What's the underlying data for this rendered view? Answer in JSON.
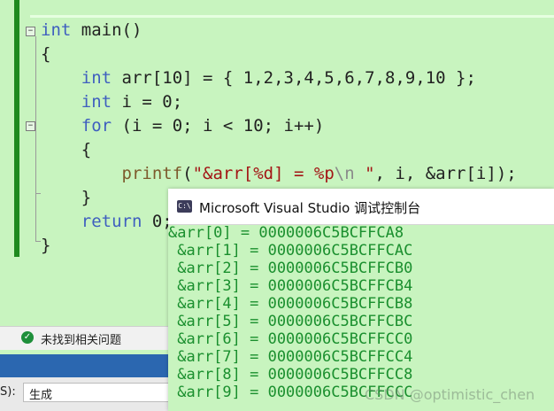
{
  "editor": {
    "lines": [
      {
        "parts": [
          {
            "t": "int",
            "c": "kw"
          },
          {
            "t": " main()",
            "c": ""
          }
        ]
      },
      {
        "parts": [
          {
            "t": "{",
            "c": ""
          }
        ]
      },
      {
        "parts": [
          {
            "t": "    ",
            "c": ""
          },
          {
            "t": "int",
            "c": "kw"
          },
          {
            "t": " arr[10] = { 1,2,3,4,5,6,7,8,9,10 };",
            "c": ""
          }
        ]
      },
      {
        "parts": [
          {
            "t": "    ",
            "c": ""
          },
          {
            "t": "int",
            "c": "kw"
          },
          {
            "t": " i = 0;",
            "c": ""
          }
        ]
      },
      {
        "parts": [
          {
            "t": "    ",
            "c": ""
          },
          {
            "t": "for",
            "c": "kw"
          },
          {
            "t": " (i = 0; i < 10; i++)",
            "c": ""
          }
        ]
      },
      {
        "parts": [
          {
            "t": "    {",
            "c": ""
          }
        ]
      },
      {
        "parts": [
          {
            "t": "        ",
            "c": ""
          },
          {
            "t": "printf",
            "c": "fn"
          },
          {
            "t": "(",
            "c": ""
          },
          {
            "t": "\"&arr[%d] = %p",
            "c": "str"
          },
          {
            "t": "\\n",
            "c": "esc"
          },
          {
            "t": " \"",
            "c": "str"
          },
          {
            "t": ", i, &arr[i]);",
            "c": ""
          }
        ]
      },
      {
        "parts": [
          {
            "t": "    }",
            "c": ""
          }
        ]
      },
      {
        "parts": [
          {
            "t": "    ",
            "c": ""
          },
          {
            "t": "return",
            "c": "kw"
          },
          {
            "t": " 0;",
            "c": ""
          }
        ]
      },
      {
        "parts": [
          {
            "t": "}",
            "c": ""
          }
        ]
      }
    ]
  },
  "status": {
    "message": "未找到相关问题",
    "check_icon": "check-circle-icon"
  },
  "output": {
    "label": "S):",
    "selected": "生成"
  },
  "console": {
    "title": "Microsoft Visual Studio 调试控制台",
    "icon_text": "C:\\",
    "lines": [
      "&arr[0] = 0000006C5BCFFCA8",
      " &arr[1] = 0000006C5BCFFCAC",
      " &arr[2] = 0000006C5BCFFCB0",
      " &arr[3] = 0000006C5BCFFCB4",
      " &arr[4] = 0000006C5BCFFCB8",
      " &arr[5] = 0000006C5BCFFCBC",
      " &arr[6] = 0000006C5BCFFCC0",
      " &arr[7] = 0000006C5BCFFCC4",
      " &arr[8] = 0000006C5BCFFCC8",
      " &arr[9] = 0000006C5BCFFCCC"
    ]
  },
  "watermark": "CSDN @optimistic_chen",
  "colors": {
    "editor_bg": "#c8f4bf",
    "keyword": "#3f5fbf",
    "console_text": "#1a8f2e",
    "change_bar": "#1f8a1f",
    "blue_band": "#2b67b0"
  }
}
